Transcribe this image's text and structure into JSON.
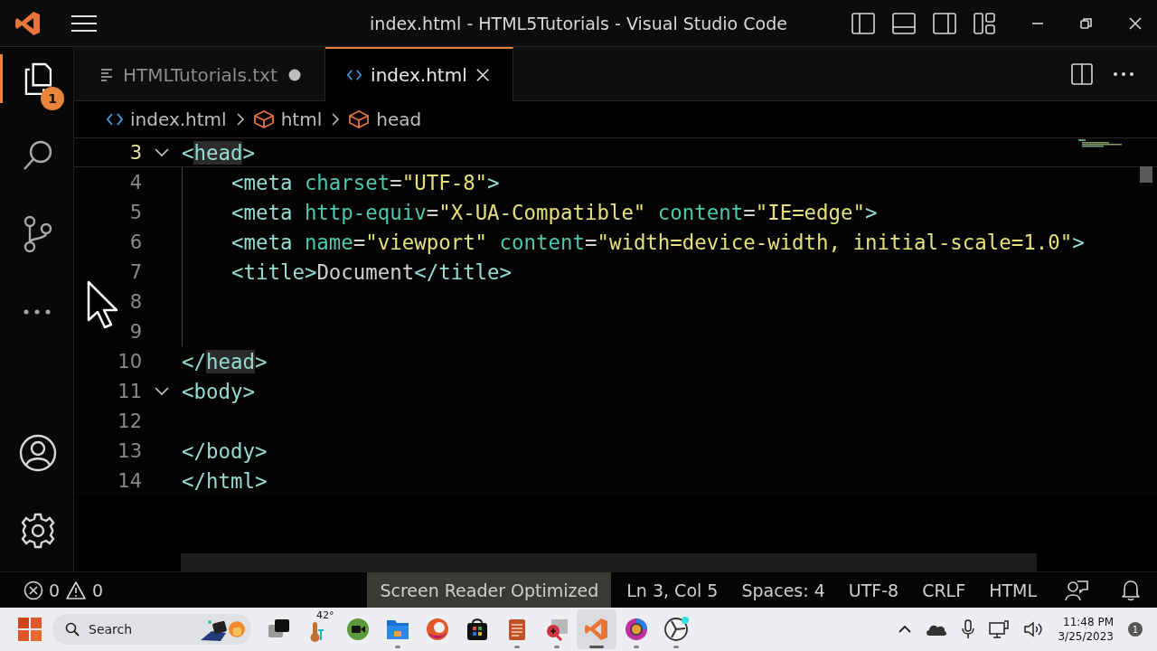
{
  "window": {
    "title": "index.html - HTML5Tutorials - Visual Studio Code"
  },
  "activity_bar": {
    "items": [
      {
        "kind": "files",
        "selected": true,
        "badge": "1"
      },
      {
        "kind": "search",
        "selected": false
      },
      {
        "kind": "source-control",
        "selected": false
      },
      {
        "kind": "more",
        "selected": false
      }
    ],
    "bottom": [
      {
        "kind": "account"
      },
      {
        "kind": "settings"
      }
    ]
  },
  "tabs": [
    {
      "label": "HTMLTutorials.txt",
      "kind": "text",
      "selected": false,
      "modified": true
    },
    {
      "label": "index.html",
      "kind": "html",
      "selected": true,
      "modified": false
    }
  ],
  "breadcrumbs": [
    {
      "label": "index.html",
      "kind": "file"
    },
    {
      "label": "html",
      "kind": "element"
    },
    {
      "label": "head",
      "kind": "element"
    }
  ],
  "editor": {
    "lines": [
      {
        "number": "3",
        "current": true,
        "foldable": true,
        "indented": false,
        "tokens": [
          {
            "kind": "tag",
            "text": "<"
          },
          {
            "kind": "tag",
            "text": "head",
            "highlighted": true
          },
          {
            "kind": "tag",
            "text": ">"
          }
        ]
      },
      {
        "number": "4",
        "current": false,
        "foldable": false,
        "indented": true,
        "tokens": [
          {
            "kind": "tag",
            "text": "<meta"
          },
          {
            "kind": "attr",
            "text": " charset"
          },
          {
            "kind": "plain",
            "text": "="
          },
          {
            "kind": "string",
            "text": "\"UTF-8\""
          },
          {
            "kind": "tag",
            "text": ">"
          }
        ]
      },
      {
        "number": "5",
        "current": false,
        "foldable": false,
        "indented": true,
        "tokens": [
          {
            "kind": "tag",
            "text": "<meta"
          },
          {
            "kind": "attr",
            "text": " http-equiv"
          },
          {
            "kind": "plain",
            "text": "="
          },
          {
            "kind": "string",
            "text": "\"X-UA-Compatible\""
          },
          {
            "kind": "attr",
            "text": " content"
          },
          {
            "kind": "plain",
            "text": "="
          },
          {
            "kind": "string",
            "text": "\"IE=edge\""
          },
          {
            "kind": "tag",
            "text": ">"
          }
        ]
      },
      {
        "number": "6",
        "current": false,
        "foldable": false,
        "indented": true,
        "tokens": [
          {
            "kind": "tag",
            "text": "<meta"
          },
          {
            "kind": "attr",
            "text": " name"
          },
          {
            "kind": "plain",
            "text": "="
          },
          {
            "kind": "string",
            "text": "\"viewport\""
          },
          {
            "kind": "attr",
            "text": " content"
          },
          {
            "kind": "plain",
            "text": "="
          },
          {
            "kind": "string",
            "text": "\"width=device-width, initial-scale=1.0\""
          },
          {
            "kind": "tag",
            "text": ">"
          }
        ]
      },
      {
        "number": "7",
        "current": false,
        "foldable": false,
        "indented": true,
        "tokens": [
          {
            "kind": "tag",
            "text": "<title>"
          },
          {
            "kind": "plain",
            "text": "Document"
          },
          {
            "kind": "tag",
            "text": "</title>"
          }
        ]
      },
      {
        "number": "8",
        "current": false,
        "foldable": false,
        "indented": true
      },
      {
        "number": "9",
        "current": false,
        "foldable": false,
        "indented": true
      },
      {
        "number": "10",
        "current": false,
        "foldable": false,
        "indented": false,
        "tokens": [
          {
            "kind": "tag",
            "text": "</"
          },
          {
            "kind": "tag",
            "text": "head",
            "highlighted": true
          },
          {
            "kind": "tag",
            "text": ">"
          }
        ]
      },
      {
        "number": "11",
        "current": false,
        "foldable": true,
        "indented": false,
        "tokens": [
          {
            "kind": "tag",
            "text": "<body>"
          }
        ]
      },
      {
        "number": "12",
        "current": false,
        "foldable": false,
        "indented": false
      },
      {
        "number": "13",
        "current": false,
        "foldable": false,
        "indented": false,
        "tokens": [
          {
            "kind": "tag",
            "text": "</body>"
          }
        ]
      },
      {
        "number": "14",
        "current": false,
        "foldable": false,
        "indented": false,
        "tokens": [
          {
            "kind": "tag",
            "text": "</html>"
          }
        ]
      }
    ]
  },
  "status_bar": {
    "errors": "0",
    "warnings": "0",
    "items": [
      {
        "label": "Screen Reader Optimized",
        "highlighted": true
      },
      {
        "label": "Ln 3, Col 5",
        "highlighted": false
      },
      {
        "label": "Spaces: 4",
        "highlighted": false
      },
      {
        "label": "UTF-8",
        "highlighted": false
      },
      {
        "label": "CRLF",
        "highlighted": false
      },
      {
        "label": "HTML",
        "highlighted": false
      }
    ]
  },
  "taskbar": {
    "search": {
      "placeholder": "Search"
    },
    "apps": [
      {
        "kind": "task-view",
        "running": false,
        "selected": false
      },
      {
        "kind": "weather",
        "label": "42°",
        "running": false,
        "selected": false
      },
      {
        "kind": "meet",
        "running": false,
        "selected": false
      },
      {
        "kind": "folder",
        "running": true,
        "selected": false
      },
      {
        "kind": "browser-swirl",
        "running": false,
        "selected": false
      },
      {
        "kind": "store",
        "running": false,
        "selected": false
      },
      {
        "kind": "notepad",
        "running": true,
        "selected": false
      },
      {
        "kind": "snip",
        "running": true,
        "selected": false
      },
      {
        "kind": "code",
        "running": true,
        "selected": true
      },
      {
        "kind": "browser-circle",
        "running": true,
        "selected": false
      },
      {
        "kind": "recorder",
        "running": true,
        "selected": false
      }
    ],
    "time": "11:48 PM",
    "date": "3/25/2023",
    "notifications": "1"
  }
}
